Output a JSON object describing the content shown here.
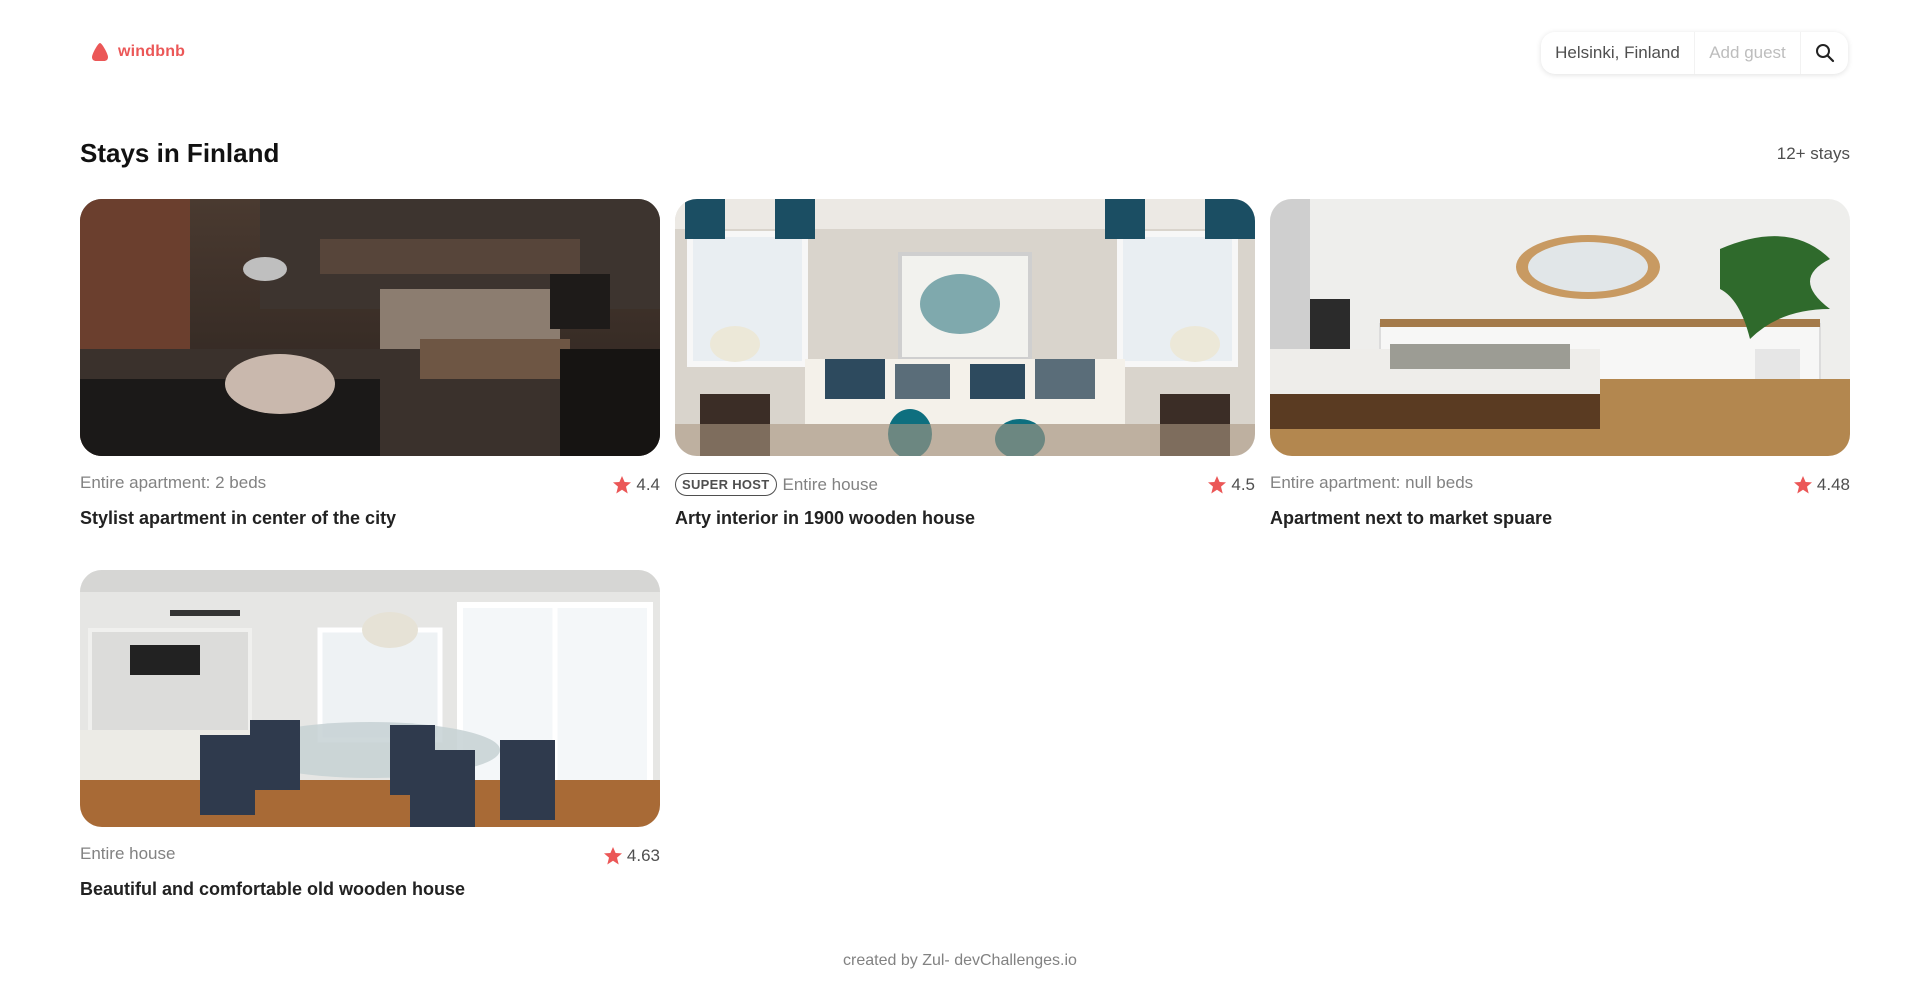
{
  "brand": {
    "name": "windbnb",
    "accent": "#EB5757"
  },
  "search": {
    "location": "Helsinki, Finland",
    "guest_placeholder": "Add guest",
    "button_icon": "search-icon"
  },
  "main": {
    "title": "Stays in Finland",
    "count": "12+ stays"
  },
  "stays": [
    {
      "type": "Entire apartment: 2 beds",
      "superhost": false,
      "rating": "4.4",
      "title": "Stylist apartment in center of the city"
    },
    {
      "type": "Entire house",
      "superhost": true,
      "superhost_label": "SUPER HOST",
      "rating": "4.5",
      "title": "Arty interior in 1900 wooden house"
    },
    {
      "type": "Entire apartment: null beds",
      "superhost": false,
      "rating": "4.48",
      "title": "Apartment next to market spuare"
    },
    {
      "type": "Entire house",
      "superhost": false,
      "rating": "4.63",
      "title": "Beautiful and comfortable old wooden house"
    }
  ],
  "footer": {
    "text": "created by Zul- devChallenges.io"
  }
}
